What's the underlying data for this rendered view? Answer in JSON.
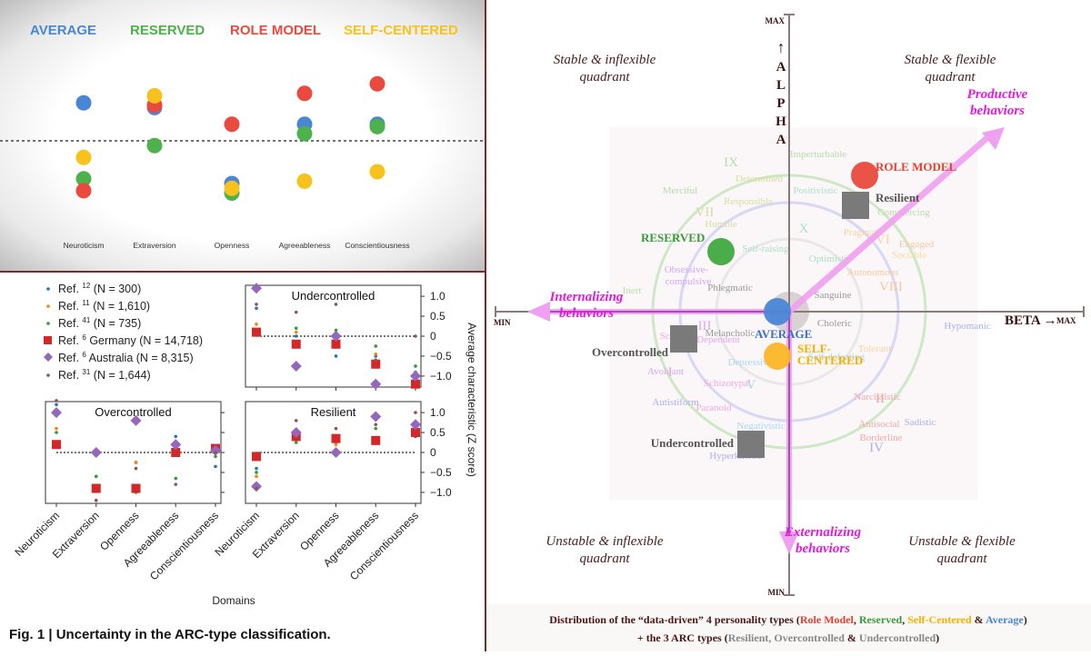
{
  "chart_data": [
    {
      "type": "scatter",
      "title": "",
      "legend": [
        "AVERAGE",
        "RESERVED",
        "ROLE MODEL",
        "SELF-CENTERED"
      ],
      "legend_position": "top",
      "categories": [
        "Neuroticism",
        "Extraversion",
        "Openness",
        "Agreeableness",
        "Conscientiousness"
      ],
      "reference_line": 0,
      "ylim": [
        -1.3,
        1.3
      ],
      "series": [
        {
          "name": "AVERAGE",
          "color": "#4a86d6",
          "values": [
            0.8,
            0.7,
            -0.9,
            0.35,
            0.35
          ]
        },
        {
          "name": "RESERVED",
          "color": "#4db14c",
          "values": [
            -0.8,
            -0.1,
            -1.1,
            0.15,
            0.3
          ]
        },
        {
          "name": "ROLE MODEL",
          "color": "#ea4a3d",
          "values": [
            -1.05,
            0.75,
            0.35,
            1.0,
            1.2
          ]
        },
        {
          "name": "SELF-CENTERED",
          "color": "#f7c21c",
          "values": [
            -0.35,
            0.95,
            -1.0,
            -0.85,
            -0.65
          ]
        }
      ]
    },
    {
      "type": "scatter",
      "title": "Fig. 1 | Uncertainty in the ARC-type classification.",
      "xlabel": "Domains",
      "ylabel": "Average characteristic (Z score)",
      "ylim": [
        -1.25,
        1.25
      ],
      "yticks": [
        "1.0",
        "0.5",
        "0",
        "−0.5",
        "−1.0"
      ],
      "ytick_values": [
        1.0,
        0.5,
        0,
        -0.5,
        -1.0
      ],
      "categories": [
        "Neuroticism",
        "Extraversion",
        "Openness",
        "Agreeableness",
        "Conscientiousness"
      ],
      "legend": [
        {
          "ref": "Ref.",
          "sup": "12",
          "text": "(N = 300)",
          "color": "#1f77b4",
          "marker": "dot"
        },
        {
          "ref": "Ref.",
          "sup": "11",
          "text": "(N = 1,610)",
          "color": "#ff7f0e",
          "marker": "dot"
        },
        {
          "ref": "Ref.",
          "sup": "41",
          "text": "(N = 735)",
          "color": "#2ca02c",
          "marker": "dot"
        },
        {
          "ref": "Ref.",
          "sup": "6",
          "text": "Germany (N = 14,718)",
          "color": "#d62728",
          "marker": "square"
        },
        {
          "ref": "Ref.",
          "sup": "6",
          "text": "Australia (N = 8,315)",
          "color": "#9467bd",
          "marker": "diamond"
        },
        {
          "ref": "Ref.",
          "sup": "31",
          "text": "(N = 1,644)",
          "color": "#8c564b",
          "marker": "dot"
        }
      ],
      "panels": [
        {
          "name": "Undercontrolled",
          "series": [
            [
              0.7,
              0.0,
              -0.5,
              -0.5,
              -0.9
            ],
            [
              0.3,
              0.1,
              -0.05,
              -0.45,
              -0.9
            ],
            [
              0.1,
              0.2,
              0.15,
              -0.25,
              -0.75
            ],
            [
              0.1,
              -0.2,
              -0.2,
              -0.7,
              -1.2
            ],
            [
              1.2,
              -0.75,
              0.0,
              -1.2,
              -1.0
            ],
            [
              0.8,
              0.6,
              0.8,
              -0.6,
              0.0
            ]
          ]
        },
        {
          "name": "Overcontrolled",
          "series": [
            [
              1.2,
              0.0,
              -0.25,
              0.4,
              -0.35
            ],
            [
              0.6,
              0.0,
              -0.25,
              0.0,
              0.05
            ],
            [
              0.5,
              -0.6,
              -1.0,
              -0.65,
              -0.1
            ],
            [
              0.2,
              -0.9,
              -0.9,
              0.0,
              0.1
            ],
            [
              1.0,
              0.0,
              0.8,
              0.2,
              0.05
            ],
            [
              1.3,
              -1.2,
              -0.4,
              -0.8,
              0.0
            ]
          ]
        },
        {
          "name": "Resilient",
          "series": [
            [
              -0.4,
              0.4,
              0.25,
              0.3,
              0.4
            ],
            [
              -0.6,
              0.35,
              0.2,
              0.3,
              0.45
            ],
            [
              -0.5,
              0.25,
              0.3,
              0.6,
              0.6
            ],
            [
              -0.1,
              0.4,
              0.35,
              0.3,
              0.5
            ],
            [
              -0.85,
              0.5,
              0.0,
              0.9,
              0.7
            ],
            [
              -0.9,
              0.8,
              0.6,
              0.7,
              1.0
            ]
          ]
        }
      ]
    },
    {
      "type": "scatter",
      "title": "Distribution of the “data-driven” 4 personality types (Role Model, Reserved, Self-Centered & Average) + the 3 ARC types (Resilient, Overcontrolled & Undercontrolled)",
      "xlabel": "BETA",
      "ylabel": "ALPHA",
      "xlim": [
        "MIN",
        "MAX"
      ],
      "ylim": [
        "MIN",
        "MAX"
      ],
      "quadrants": {
        "top_left": [
          "Stable & inflexible",
          "quadrant"
        ],
        "top_right": [
          "Stable & flexible",
          "quadrant"
        ],
        "bottom_left": [
          "Unstable & inflexible",
          "quadrant"
        ],
        "bottom_right": [
          "Unstable & flexible",
          "quadrant"
        ]
      },
      "arrows": [
        {
          "label": [
            "Productive",
            "behaviors"
          ],
          "direction": "up-right"
        },
        {
          "label": [
            "Internalizing",
            "behaviors"
          ],
          "direction": "left"
        },
        {
          "label": [
            "Externalizing",
            "behaviors"
          ],
          "direction": "down"
        }
      ],
      "types": [
        {
          "name": "ROLE MODEL",
          "color": "#ea4a3d",
          "shape": "circle",
          "x": 0.27,
          "y": 0.53
        },
        {
          "name": "RESERVED",
          "color": "#3fa93f",
          "shape": "circle",
          "x": -0.27,
          "y": 0.22
        },
        {
          "name": "AVERAGE",
          "color": "#4a86d6",
          "shape": "circle",
          "x": 0.0,
          "y": 0.0
        },
        {
          "name": "SELF-CENTERED",
          "color": "#fbb626",
          "shape": "circle",
          "x": 0.0,
          "y": -0.17
        },
        {
          "name": "Resilient",
          "color": "#7a7a7a",
          "shape": "square",
          "x": 0.27,
          "y": 0.4
        },
        {
          "name": "Overcontrolled",
          "color": "#7a7a7a",
          "shape": "square",
          "x": -0.34,
          "y": -0.11
        },
        {
          "name": "Undercontrolled",
          "color": "#7a7a7a",
          "shape": "square",
          "x": -0.1,
          "y": -0.51
        }
      ],
      "background_labels": [
        {
          "t": "IX",
          "c": "#b8dcaa"
        },
        {
          "t": "Imperturbable",
          "c": "#b8dcaa"
        },
        {
          "t": "Determined",
          "c": "#d8dca0"
        },
        {
          "t": "Merciful",
          "c": "#b8dcaa"
        },
        {
          "t": "Responsible",
          "c": "#d8dca0"
        },
        {
          "t": "VII",
          "c": "#d8dca0"
        },
        {
          "t": "Humble",
          "c": "#d8dca0"
        },
        {
          "t": "Self-raising",
          "c": "#a8e0c8"
        },
        {
          "t": "Positivistic",
          "c": "#a8e0c8"
        },
        {
          "t": "X",
          "c": "#a8e0c8"
        },
        {
          "t": "Optimistic",
          "c": "#a8e0c8"
        },
        {
          "t": "Pragmatic",
          "c": "#f5d5a0"
        },
        {
          "t": "Commercing",
          "c": "#b8dcaa"
        },
        {
          "t": "VI",
          "c": "#f5d5a0"
        },
        {
          "t": "Engaged",
          "c": "#f5c8a0"
        },
        {
          "t": "Autonomous",
          "c": "#f5c8a0"
        },
        {
          "t": "VIII",
          "c": "#f5c8a0"
        },
        {
          "t": "Sociable",
          "c": "#f5dca0"
        },
        {
          "t": "Inert",
          "c": "#b8dcaa"
        },
        {
          "t": "Obsessive-",
          "c": "#d0a8f0"
        },
        {
          "t": "compulsive",
          "c": "#d0a8f0"
        },
        {
          "t": "Phlegmatic",
          "c": "#999999"
        },
        {
          "t": "Sanguine",
          "c": "#999999"
        },
        {
          "t": "Melancholic",
          "c": "#999999"
        },
        {
          "t": "Choleric",
          "c": "#999999"
        },
        {
          "t": "III",
          "c": "#e0a8f0"
        },
        {
          "t": "Schizoid",
          "c": "#f0a8e0"
        },
        {
          "t": "Dependent",
          "c": "#e0a8f0"
        },
        {
          "t": "Avoidant",
          "c": "#d0a8f0"
        },
        {
          "t": "Depressive",
          "c": "#a8d8f0"
        },
        {
          "t": "Self-defeating",
          "c": "#a8d8f0"
        },
        {
          "t": "Tolerant",
          "c": "#f5d5a0"
        },
        {
          "t": "Hypomanic",
          "c": "#a8b0f0"
        },
        {
          "t": "I",
          "c": "#f0a8e0"
        },
        {
          "t": "Schizotypal",
          "c": "#f0a8e0"
        },
        {
          "t": "Paranoid",
          "c": "#f0a8e0"
        },
        {
          "t": "V",
          "c": "#a8d8f0"
        },
        {
          "t": "Narcissistic",
          "c": "#f0a8a8"
        },
        {
          "t": "II",
          "c": "#f0a8a8"
        },
        {
          "t": "Autistiform",
          "c": "#a8b0f0"
        },
        {
          "t": "Negativistic",
          "c": "#a8d8f0"
        },
        {
          "t": "Antisocial",
          "c": "#f0a8a8"
        },
        {
          "t": "Sadistic",
          "c": "#a8b0f0"
        },
        {
          "t": "Borderline",
          "c": "#f0a8a8"
        },
        {
          "t": "IV",
          "c": "#a8b0f0"
        },
        {
          "t": "Hyperkinetic",
          "c": "#a8b0f0"
        }
      ]
    }
  ],
  "caption": {
    "fig": "Fig. 1 |",
    "text": "Uncertainty in the ARC-type classification."
  },
  "footer": {
    "line1_prefix": "Distribution of the “data-driven” 4 personality types (",
    "role_model": "Role Model",
    "reserved": "Reserved",
    "self_centered": "Self-Centered",
    "average": "Average",
    "line2_prefix": "+ the 3 ARC types (",
    "arc": "Resilient, Overcontrolled",
    "arc2": "Undercontrolled"
  }
}
